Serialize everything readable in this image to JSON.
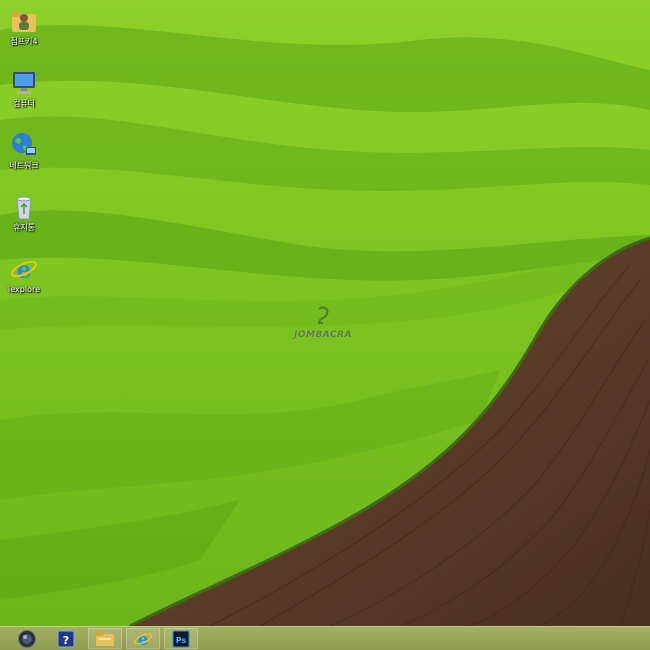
{
  "desktop": {
    "icons": [
      {
        "name": "user-folder",
        "label": "점프키4"
      },
      {
        "name": "computer",
        "label": "컴퓨터"
      },
      {
        "name": "network",
        "label": "네트워크"
      },
      {
        "name": "recycle-bin",
        "label": "휴지통"
      },
      {
        "name": "internet-explorer",
        "label": "iexplore"
      }
    ],
    "watermark": {
      "text": "JOMBACRA"
    }
  },
  "taskbar": {
    "buttons": [
      {
        "name": "start",
        "icon": "start-orb-icon"
      },
      {
        "name": "help",
        "icon": "help-icon",
        "label": "?"
      },
      {
        "name": "file-explorer",
        "icon": "folder-icon"
      },
      {
        "name": "internet-explorer",
        "icon": "ie-icon",
        "label": "e"
      },
      {
        "name": "photoshop",
        "icon": "photoshop-icon",
        "label": "Ps"
      }
    ]
  },
  "colors": {
    "field_green": "#7cc520",
    "field_dark_green": "#4f9a12",
    "soil_brown": "#5a3a26",
    "taskbar": "#9aa85a"
  }
}
